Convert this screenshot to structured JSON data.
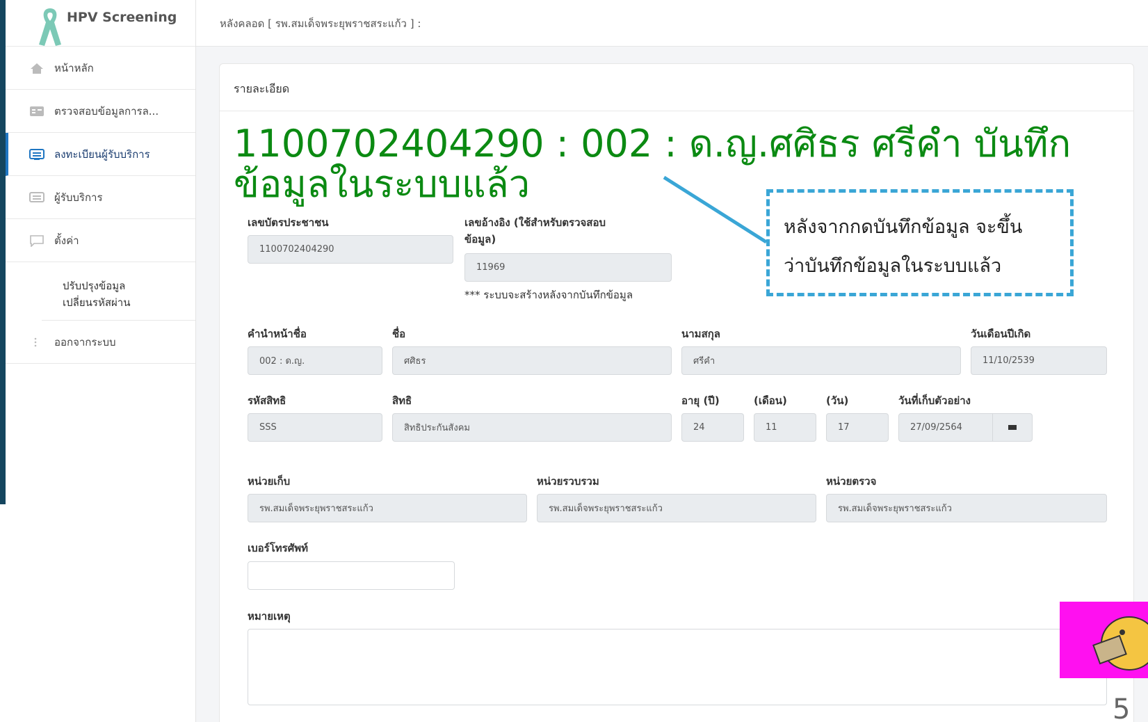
{
  "brand": {
    "name": "HPV Screening"
  },
  "sidebar": {
    "items": [
      {
        "label": "หน้าหลัก",
        "icon": "home-icon"
      },
      {
        "label": "ตรวจสอบข้อมูลการล...",
        "icon": "checklist-icon"
      },
      {
        "label": "ลงทะเบียนผู้รับบริการ",
        "icon": "register-icon"
      },
      {
        "label": "ผู้รับบริการ",
        "icon": "list-icon"
      },
      {
        "label": "ตั้งค่า",
        "icon": "chat-icon"
      }
    ],
    "sub_items": [
      "ปรับปรุงข้อมูล",
      "เปลี่ยนรหัสผ่าน"
    ],
    "logout": "ออกจากระบบ"
  },
  "topbar": {
    "breadcrumb": "หลังคลอด [ รพ.สมเด็จพระยุพราชสระแก้ว ] :"
  },
  "card": {
    "header": "รายละเอียด",
    "title_line1": "1100702404290 : 002 : ด.ญ.ศศิธร ศรีคำ บันทึก",
    "title_line2": "ข้อมูลในระบบแล้ว"
  },
  "form": {
    "citizen_id": {
      "label": "เลขบัตรประชาชน",
      "value": "1100702404290"
    },
    "ref_no": {
      "label_line1": "เลขอ้างอิง (ใช้สำหรับตรวจสอบ",
      "label_line2": "ข้อมูล)",
      "value": "11969",
      "note": "*** ระบบจะสร้างหลังจากบันทึกข้อมูล"
    },
    "prefix": {
      "label": "คำนำหน้าชื่อ",
      "value": "002 : ด.ญ."
    },
    "first_name": {
      "label": "ชื่อ",
      "value": "ศศิธร"
    },
    "last_name": {
      "label": "นามสกุล",
      "value": "ศรีคำ"
    },
    "birth_date": {
      "label": "วันเดือนปีเกิด",
      "value": "11/10/2539"
    },
    "right_code": {
      "label": "รหัสสิทธิ",
      "value": "SSS"
    },
    "right": {
      "label": "สิทธิ",
      "value": "สิทธิประกันสังคม"
    },
    "age_year": {
      "label": "อายุ (ปี)",
      "value": "24"
    },
    "age_month": {
      "label": "(เดือน)",
      "value": "11"
    },
    "age_day": {
      "label": "(วัน)",
      "value": "17"
    },
    "collect_date": {
      "label": "วันที่เก็บตัวอย่าง",
      "value": "27/09/2564"
    },
    "collect_unit": {
      "label": "หน่วยเก็บ",
      "value": "รพ.สมเด็จพระยุพราชสระแก้ว"
    },
    "gather_unit": {
      "label": "หน่วยรวบรวม",
      "value": "รพ.สมเด็จพระยุพราชสระแก้ว"
    },
    "exam_unit": {
      "label": "หน่วยตรวจ",
      "value": "รพ.สมเด็จพระยุพราชสระแก้ว"
    },
    "phone": {
      "label": "เบอร์โทรศัพท์",
      "value": ""
    },
    "remark": {
      "label": "หมายเหตุ",
      "value": ""
    }
  },
  "callout": {
    "line1": "หลังจากกดบันทึกข้อมูล จะขึ้น",
    "line2": "ว่าบันทึกข้อมูลในระบบแล้ว",
    "border_color": "#3aa6d6"
  },
  "page_number": "5",
  "colors": {
    "title_green": "#0b8a12",
    "accent_blue": "#1f76c2",
    "frame": "#15465f"
  }
}
